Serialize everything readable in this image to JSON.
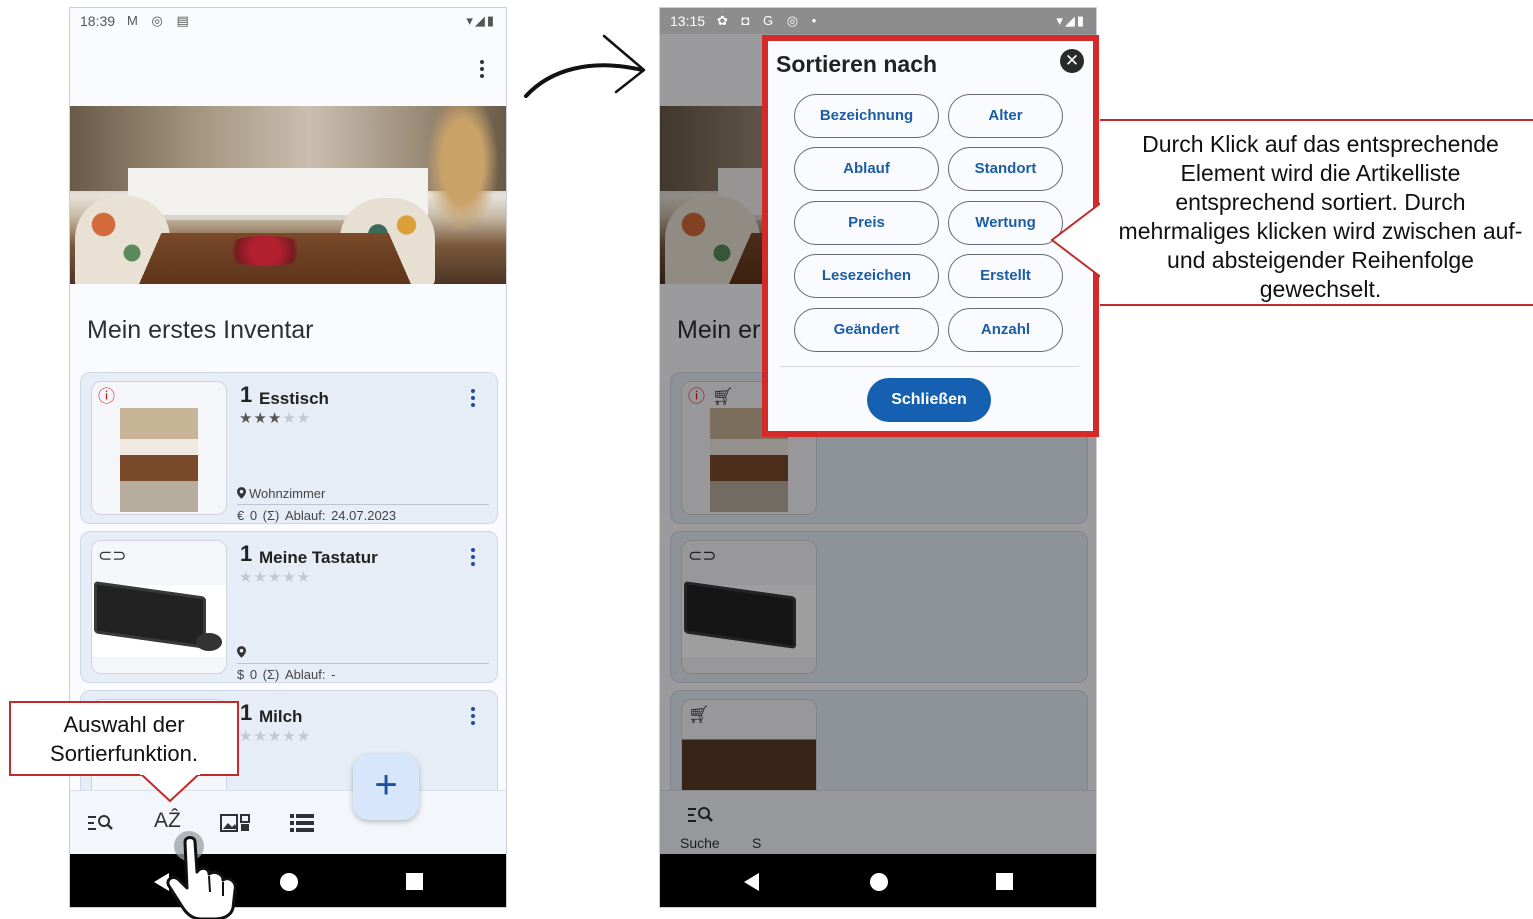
{
  "left_phone": {
    "status_time": "18:39",
    "status_icons": "M ◎ ▤",
    "status_right": "▾◢▮",
    "inventory_title": "Mein erstes Inventar",
    "items": [
      {
        "qty": "1",
        "name": "Esstisch",
        "stars_on": "★★★",
        "stars_off": "★★",
        "location": "Wohnzimmer",
        "meta": "€ 0  (Σ)   Ablauf: 24.07.2023"
      },
      {
        "qty": "1",
        "name": "Meine Tastatur",
        "stars_on": "",
        "stars_off": "★★★★★",
        "location": "",
        "meta": "$ 0  (Σ)   Ablauf: -"
      },
      {
        "qty": "1",
        "name": "Milch",
        "stars_on": "",
        "stars_off": "★★★★★"
      }
    ],
    "fab_label": "+"
  },
  "right_phone": {
    "status_time": "13:15",
    "status_icons": "✿ ◘ G ◎ •",
    "status_right": "▾◢▮",
    "inventory_title_partial": "Mein er",
    "nav_label_search": "Suche",
    "nav_label_partial": "S"
  },
  "sort_dialog": {
    "title": "Sortieren nach",
    "close_glyph": "✕",
    "options": [
      "Bezeichnung",
      "Alter",
      "Ablauf",
      "Standort",
      "Preis",
      "Wertung",
      "Lesezeichen",
      "Erstellt",
      "Geändert",
      "Anzahl"
    ],
    "close_button": "Schließen"
  },
  "annotations": {
    "right_callout": "Durch Klick auf das entsprechende Element wird die Artikelliste entsprechend sortiert. Durch mehrmaliges klicken wird zwischen auf- und absteigender Reihenfolge gewechselt.",
    "left_callout": "Auswahl der Sortierfunktion."
  },
  "colors": {
    "accent_blue": "#1560b0",
    "callout_red": "#c22b2b",
    "dialog_border_red": "#d42a2a"
  }
}
